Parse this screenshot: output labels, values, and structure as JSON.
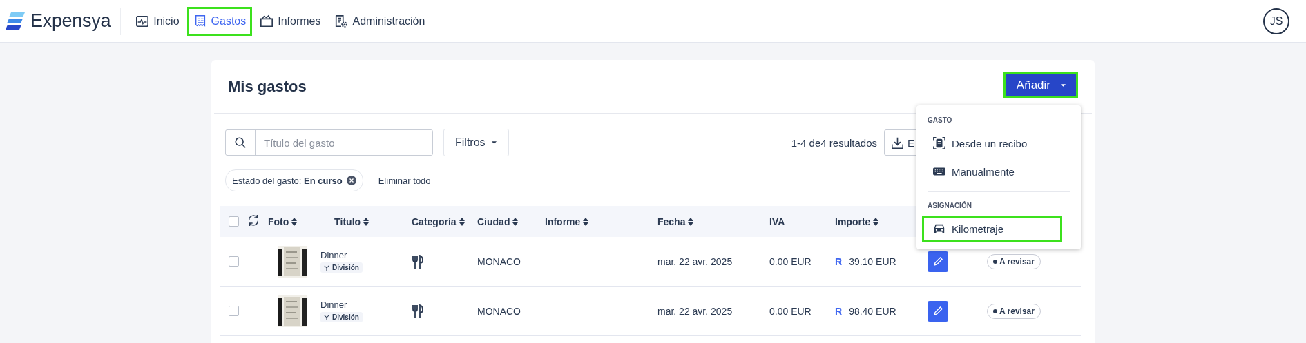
{
  "nav": {
    "logo": "Expensya",
    "items": [
      {
        "label": "Inicio",
        "kind": "activity",
        "selected": false,
        "highlighted": false
      },
      {
        "label": "Gastos",
        "kind": "receipt",
        "selected": true,
        "highlighted": true
      },
      {
        "label": "Informes",
        "kind": "folder",
        "selected": false,
        "highlighted": false
      },
      {
        "label": "Administración",
        "kind": "settings",
        "selected": false,
        "highlighted": false
      }
    ],
    "avatar": "JS"
  },
  "page": {
    "title": "Mis gastos",
    "add_button": {
      "label": "Añadir",
      "highlighted": true
    }
  },
  "search": {
    "placeholder": "Título del gasto"
  },
  "filters_button": "Filtros",
  "results": "1-4 de4 resultados",
  "export_button": "E",
  "filter_chips": [
    {
      "label": "Estado del gasto: **En curso**"
    }
  ],
  "clear_all": "Eliminar todo",
  "table": {
    "all_checked": false,
    "columns": [
      {
        "label": "Foto",
        "sortable": true
      },
      {
        "label": "Título",
        "sortable": true
      },
      {
        "label": "Categoría",
        "sortable": true
      },
      {
        "label": "Ciudad",
        "sortable": true
      },
      {
        "label": "Informe",
        "sortable": true
      },
      {
        "label": "Fecha",
        "sortable": true
      },
      {
        "label": "IVA",
        "sortable": false
      },
      {
        "label": "Importe",
        "sortable": true
      }
    ],
    "rows": [
      {
        "checked": false,
        "title": "Dinner",
        "tag": "División",
        "city": "MONACO",
        "date": "mar. 22 avr. 2025",
        "vat": "0.00 EUR",
        "amount_flag": "R",
        "amount": "39.10 EUR",
        "status": "A revisar"
      },
      {
        "checked": false,
        "title": "Dinner",
        "tag": "División",
        "city": "MONACO",
        "date": "mar. 22 avr. 2025",
        "vat": "0.00 EUR",
        "amount_flag": "R",
        "amount": "98.40 EUR",
        "status": "A revisar"
      }
    ]
  },
  "add_menu": {
    "sections": [
      {
        "heading": "GASTO",
        "items": [
          {
            "label": "Desde un recibo",
            "kind": "scan",
            "highlighted": false
          },
          {
            "label": "Manualmente",
            "kind": "keyboard",
            "highlighted": false
          }
        ]
      },
      {
        "heading": "ASIGNACIÓN",
        "items": [
          {
            "label": "Kilometraje",
            "kind": "car",
            "highlighted": true
          }
        ]
      }
    ]
  }
}
